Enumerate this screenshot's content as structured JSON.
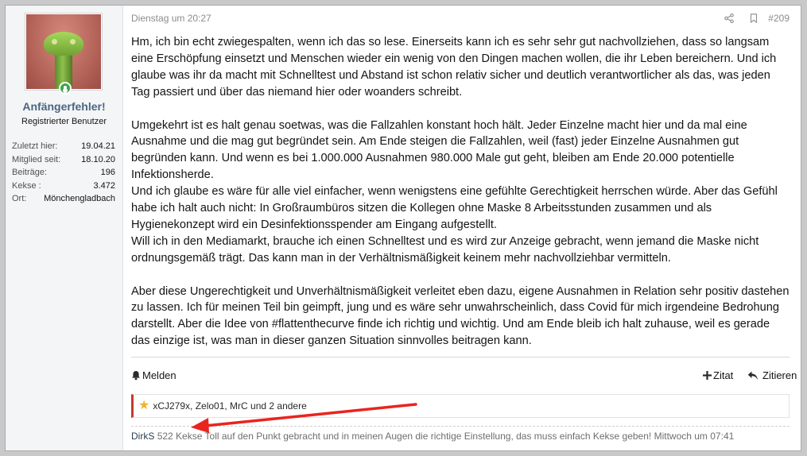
{
  "user": {
    "name": "Anfängerfehler!",
    "title": "Registrierter Benutzer",
    "stats": [
      {
        "label": "Zuletzt hier:",
        "value": "19.04.21"
      },
      {
        "label": "Mitglied seit:",
        "value": "18.10.20"
      },
      {
        "label": "Beiträge:",
        "value": "196"
      },
      {
        "label": "Kekse :",
        "value": "3.472"
      },
      {
        "label": "Ort:",
        "value": "Mönchengladbach"
      }
    ]
  },
  "post": {
    "date": "Dienstag um 20:27",
    "number": "#209",
    "paragraphs": [
      "Hm, ich bin echt zwiegespalten, wenn ich das so lese. Einerseits kann ich es sehr sehr gut nachvollziehen, dass so langsam eine Erschöpfung einsetzt und Menschen wieder ein wenig von den Dingen machen wollen, die ihr Leben bereichern. Und ich glaube was ihr da macht mit Schnelltest und Abstand ist schon relativ sicher und deutlich verantwortlicher als das, was jeden Tag passiert und über das niemand hier oder woanders schreibt.",
      "",
      "Umgekehrt ist es halt genau soetwas, was die Fallzahlen konstant hoch hält. Jeder Einzelne macht hier und da mal eine Ausnahme und die mag gut begründet sein. Am Ende steigen die Fallzahlen, weil (fast) jeder Einzelne Ausnahmen gut begründen kann. Und wenn es bei 1.000.000 Ausnahmen 980.000 Male gut geht, bleiben am Ende 20.000 potentielle Infektionsherde.",
      "Und ich glaube es wäre für alle viel einfacher, wenn wenigstens eine gefühlte Gerechtigkeit herrschen würde. Aber das Gefühl habe ich halt auch nicht: In Großraumbüros sitzen die Kollegen ohne Maske 8 Arbeitsstunden zusammen und als Hygienekonzept wird ein Desinfektionsspender am Eingang aufgestellt.",
      "Will ich in den Mediamarkt, brauche ich einen Schnelltest und es wird zur Anzeige gebracht, wenn jemand die Maske nicht ordnungsgemäß trägt. Das kann man in der Verhältnismäßigkeit keinem mehr nachvollziehbar vermitteln.",
      "",
      "Aber diese Ungerechtigkeit und Unverhältnismäßigkeit verleitet eben dazu, eigene Ausnahmen in Relation sehr positiv dastehen zu lassen. Ich für meinen Teil bin geimpft, jung und es wäre sehr unwahrscheinlich, dass Covid für mich irgendeine Bedrohung darstellt. Aber die Idee von #flattenthecurve finde ich richtig und wichtig. Und am Ende bleib ich halt zuhause, weil es gerade das einzige ist, was man in dieser ganzen Situation sinnvolles beitragen kann."
    ],
    "actions": {
      "report": "Melden",
      "quote": "Zitat",
      "reply": "Zitieren"
    },
    "reactions": "xCJ279x, Zelo01, MrC und 2 andere",
    "comment": {
      "author": "DirkS",
      "kekse": "522 Kekse",
      "text": "Toll auf den Punkt gebracht und in meinen Augen die richtige Einstellung, das muss einfach Kekse geben!",
      "time": "Mittwoch um 07:41"
    }
  },
  "colors": {
    "username": "#4b6583",
    "accent_border": "#c23a30",
    "star": "#f1b32b",
    "online": "#3fa34d",
    "annotation_arrow": "#e8251f"
  },
  "icons": [
    "share-icon",
    "bookmark-icon",
    "bell-icon",
    "plus-icon",
    "reply-icon",
    "star-icon",
    "online-status-icon"
  ]
}
